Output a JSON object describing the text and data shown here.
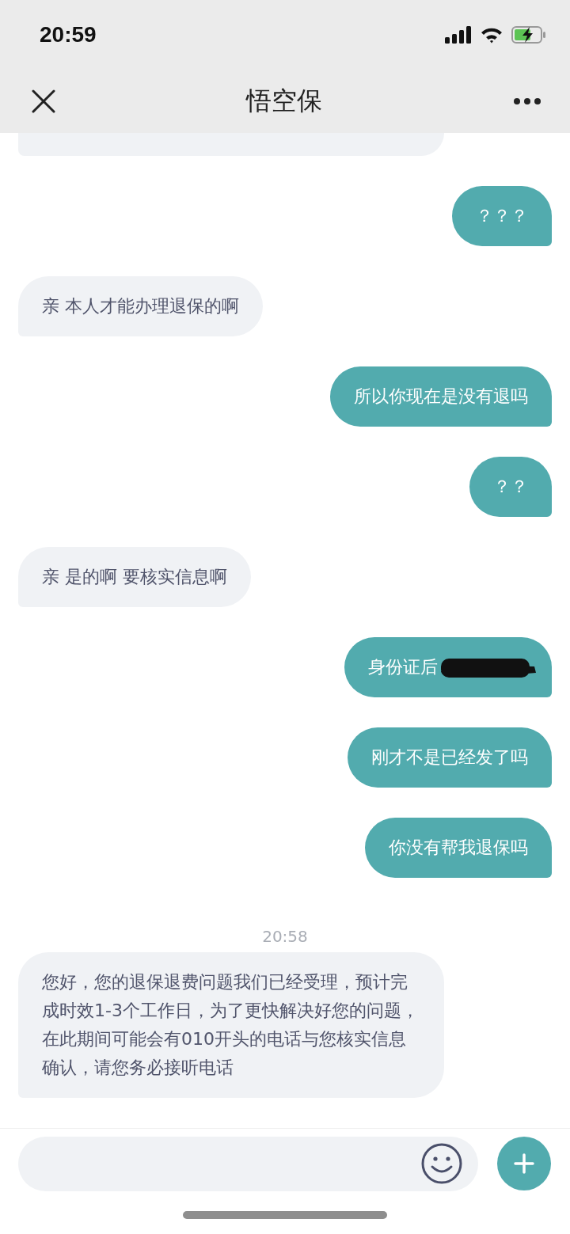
{
  "status_bar": {
    "time": "20:59"
  },
  "header": {
    "title": "悟空保"
  },
  "messages": [
    {
      "kind": "clipped"
    },
    {
      "kind": "outgoing",
      "text": "？？？"
    },
    {
      "kind": "incoming",
      "text": "亲 本人才能办理退保的啊"
    },
    {
      "kind": "outgoing",
      "text": "所以你现在是没有退吗"
    },
    {
      "kind": "outgoing",
      "text": "？？"
    },
    {
      "kind": "incoming",
      "text": "亲 是的啊 要核实信息啊"
    },
    {
      "kind": "outgoing",
      "text": "身份证后",
      "redacted": true
    },
    {
      "kind": "outgoing",
      "text": "刚才不是已经发了吗"
    },
    {
      "kind": "outgoing",
      "text": "你没有帮我退保吗"
    },
    {
      "kind": "timestamp",
      "text": "20:58"
    },
    {
      "kind": "incoming",
      "text": "您好，您的退保退费问题我们已经受理，预计完成时效1-3个工作日，为了更快解决好您的问题，在此期间可能会有010开头的电话与您核实信息确认，请您务必接听电话"
    }
  ]
}
